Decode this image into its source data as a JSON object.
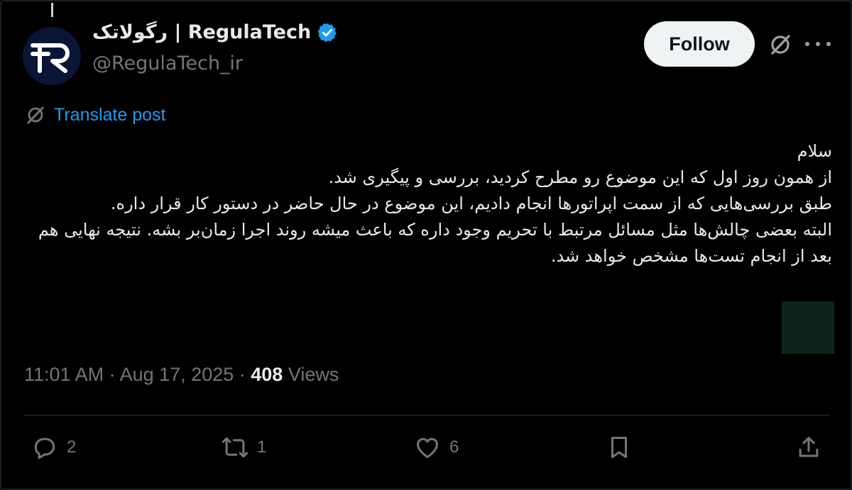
{
  "author": {
    "display_name": "رگولاتک | RegulaTech",
    "handle": "@RegulaTech_ir",
    "avatar_icon": "regulatech-logo",
    "verified": true
  },
  "header": {
    "follow_label": "Follow"
  },
  "translate": {
    "label": "Translate post"
  },
  "post": {
    "lines": [
      "سلام",
      "از همون روز اول که این موضوع رو مطرح کردید، بررسی و پیگیری شد.",
      "طبق بررسی‌هایی که از سمت اپراتورها انجام دادیم، این موضوع در حال حاضر در دستور کار قرار داره.",
      "البته بعضی چالش‌ها مثل مسائل مرتبط با تحریم وجود داره که باعث میشه روند اجرا زمان‌بر بشه. نتیجه نهایی هم بعد از انجام تست‌ها مشخص خواهد شد."
    ]
  },
  "meta": {
    "time": "11:01 AM",
    "sep1": " · ",
    "date": "Aug 17, 2025",
    "sep2": " · ",
    "views_count": "408",
    "views_label": " Views"
  },
  "actions": {
    "replies": "2",
    "reposts": "1",
    "likes": "6"
  },
  "colors": {
    "background": "#000000",
    "text": "#e7e9ea",
    "muted": "#71767b",
    "link": "#1d9bf0",
    "verified": "#1d9bf0"
  }
}
